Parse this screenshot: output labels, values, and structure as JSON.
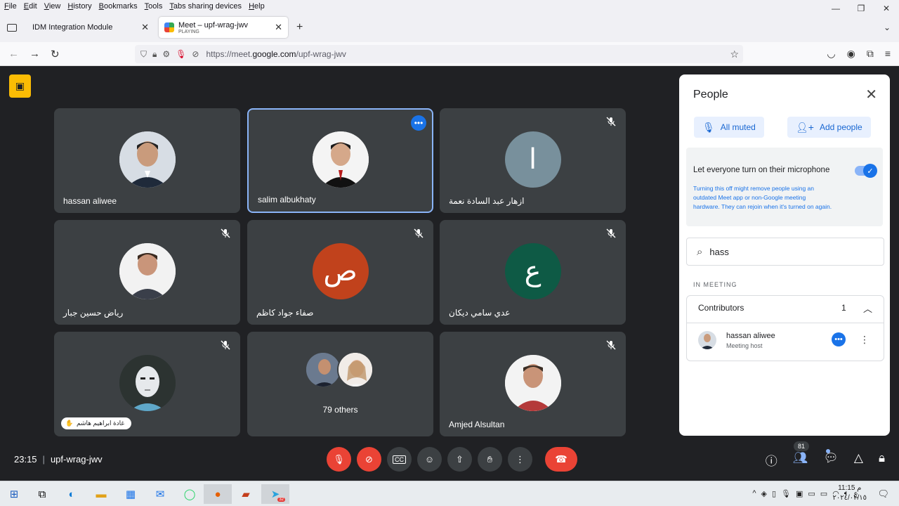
{
  "browser": {
    "menu": [
      "File",
      "Edit",
      "View",
      "History",
      "Bookmarks",
      "Tools",
      "Tabs sharing devices",
      "Help"
    ],
    "tabs": [
      {
        "label": "IDM Integration Module",
        "sub": ""
      },
      {
        "label": "Meet – upf-wrag-jwv",
        "sub": "PLAYING"
      }
    ],
    "url_prefix": "https://meet.",
    "url_domain": "google.com",
    "url_path": "/upf-wrag-jwv"
  },
  "tiles": [
    {
      "name": "hassan aliwee",
      "avatar_type": "photo",
      "muted": false,
      "active": false
    },
    {
      "name": "salim albukhaty",
      "avatar_type": "photo",
      "muted": false,
      "active": true
    },
    {
      "name": "ازهار عبد السادة نعمة",
      "avatar_type": "letter",
      "letter": "ا",
      "color": "#78909c",
      "muted": true,
      "active": false
    },
    {
      "name": "رياض حسين جبار",
      "avatar_type": "photo",
      "muted": true,
      "active": false
    },
    {
      "name": "صفاء جواد كاظم",
      "avatar_type": "letter",
      "letter": "ص",
      "color": "#c1421c",
      "muted": true,
      "active": false
    },
    {
      "name": "عدي سامي ديكان",
      "avatar_type": "letter",
      "letter": "ع",
      "color": "#0e5a45",
      "muted": true,
      "active": false
    },
    {
      "name": "غادة ابراهيم هاشم",
      "avatar_type": "photo",
      "muted": true,
      "active": false,
      "pill": true
    },
    {
      "name": "79 others",
      "avatar_type": "group",
      "muted": false,
      "active": false
    },
    {
      "name": "Amjed Alsultan",
      "avatar_type": "photo",
      "muted": true,
      "active": false
    }
  ],
  "panel": {
    "title": "People",
    "all_muted": "All muted",
    "add_people": "Add people",
    "toggle_label": "Let everyone turn on their microphone",
    "toggle_desc": "Turning this off might remove people using an outdated Meet app or non-Google meeting hardware. They can rejoin when it's turned on again.",
    "toggle_on": true,
    "search_value": "hass",
    "section_label": "IN MEETING",
    "group_label": "Contributors",
    "group_count": "1",
    "participant_name": "hassan aliwee",
    "participant_role": "Meeting host"
  },
  "bottom": {
    "time": "23:15",
    "meeting_code": "upf-wrag-jwv",
    "people_count": "81"
  },
  "taskbar": {
    "time": "11:15 م",
    "date": "٢٠٢٤/٠٢/١٥",
    "lang": "ع",
    "telegram_badge": "32"
  },
  "colors": {
    "meet_bg": "#202124",
    "tile_bg": "#3c4043",
    "accent": "#1a73e8",
    "danger": "#ea4335"
  }
}
